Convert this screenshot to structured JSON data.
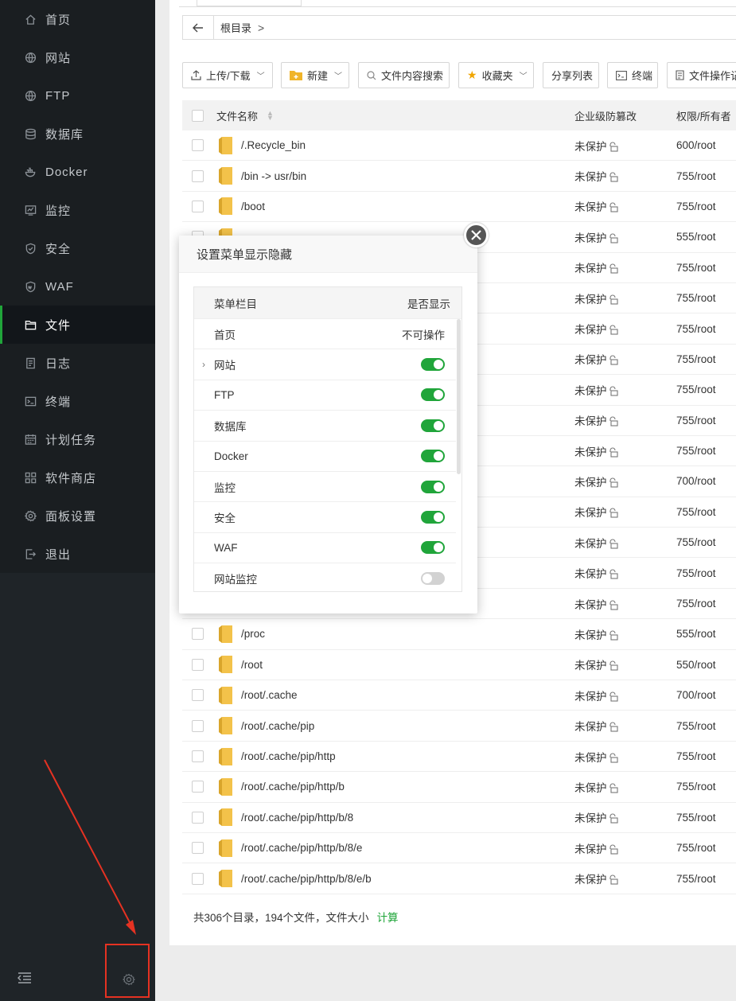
{
  "sidebar": {
    "items": [
      {
        "label": "首页",
        "icon": "home-icon"
      },
      {
        "label": "网站",
        "icon": "globe-icon"
      },
      {
        "label": "FTP",
        "icon": "ftp-globe-icon"
      },
      {
        "label": "数据库",
        "icon": "database-icon"
      },
      {
        "label": "Docker",
        "icon": "docker-icon"
      },
      {
        "label": "监控",
        "icon": "monitor-icon"
      },
      {
        "label": "安全",
        "icon": "shield-icon"
      },
      {
        "label": "WAF",
        "icon": "waf-shield-icon"
      },
      {
        "label": "文件",
        "icon": "folder-icon"
      },
      {
        "label": "日志",
        "icon": "log-icon"
      },
      {
        "label": "终端",
        "icon": "terminal-icon"
      },
      {
        "label": "计划任务",
        "icon": "calendar-icon"
      },
      {
        "label": "软件商店",
        "icon": "apps-icon"
      },
      {
        "label": "面板设置",
        "icon": "gear-icon"
      },
      {
        "label": "退出",
        "icon": "logout-icon"
      }
    ],
    "active_index": 8
  },
  "pathbar": {
    "crumb": "根目录",
    "separator": ">"
  },
  "toolbar": {
    "upload_download": "上传/下载",
    "new": "新建",
    "content_search": "文件内容搜索",
    "favorites": "收藏夹",
    "share_list": "分享列表",
    "terminal": "终端",
    "file_ops_log": "文件操作记"
  },
  "table": {
    "col_name": "文件名称",
    "col_protect": "企业级防篡改",
    "col_perm": "权限/所有者",
    "rows": [
      {
        "name": "/.Recycle_bin",
        "protect": "未保护",
        "perm": "600/root"
      },
      {
        "name": "/bin -> usr/bin",
        "protect": "未保护",
        "perm": "755/root"
      },
      {
        "name": "/boot",
        "protect": "未保护",
        "perm": "755/root"
      },
      {
        "name": "",
        "protect": "未保护",
        "perm": "555/root"
      },
      {
        "name": "",
        "protect": "未保护",
        "perm": "755/root"
      },
      {
        "name": "",
        "protect": "未保护",
        "perm": "755/root"
      },
      {
        "name": "",
        "protect": "未保护",
        "perm": "755/root"
      },
      {
        "name": "",
        "protect": "未保护",
        "perm": "755/root"
      },
      {
        "name": "",
        "protect": "未保护",
        "perm": "755/root"
      },
      {
        "name": "",
        "protect": "未保护",
        "perm": "755/root"
      },
      {
        "name": "",
        "protect": "未保护",
        "perm": "755/root"
      },
      {
        "name": "",
        "protect": "未保护",
        "perm": "700/root"
      },
      {
        "name": "",
        "protect": "未保护",
        "perm": "755/root"
      },
      {
        "name": "",
        "protect": "未保护",
        "perm": "755/root"
      },
      {
        "name": "",
        "protect": "未保护",
        "perm": "755/root"
      },
      {
        "name": "",
        "protect": "未保护",
        "perm": "755/root"
      },
      {
        "name": "/proc",
        "protect": "未保护",
        "perm": "555/root"
      },
      {
        "name": "/root",
        "protect": "未保护",
        "perm": "550/root"
      },
      {
        "name": "/root/.cache",
        "protect": "未保护",
        "perm": "700/root"
      },
      {
        "name": "/root/.cache/pip",
        "protect": "未保护",
        "perm": "755/root"
      },
      {
        "name": "/root/.cache/pip/http",
        "protect": "未保护",
        "perm": "755/root"
      },
      {
        "name": "/root/.cache/pip/http/b",
        "protect": "未保护",
        "perm": "755/root"
      },
      {
        "name": "/root/.cache/pip/http/b/8",
        "protect": "未保护",
        "perm": "755/root"
      },
      {
        "name": "/root/.cache/pip/http/b/8/e",
        "protect": "未保护",
        "perm": "755/root"
      },
      {
        "name": "/root/.cache/pip/http/b/8/e/b",
        "protect": "未保护",
        "perm": "755/root"
      }
    ]
  },
  "footer": {
    "summary": "共306个目录，194个文件，文件大小",
    "calc": "计算"
  },
  "modal": {
    "title": "设置菜单显示隐藏",
    "col_item": "菜单栏目",
    "col_show": "是否显示",
    "rows": [
      {
        "label": "首页",
        "state": "不可操作",
        "toggle": null,
        "expandable": false
      },
      {
        "label": "网站",
        "state": "",
        "toggle": true,
        "expandable": true
      },
      {
        "label": "FTP",
        "state": "",
        "toggle": true,
        "expandable": false
      },
      {
        "label": "数据库",
        "state": "",
        "toggle": true,
        "expandable": false
      },
      {
        "label": "Docker",
        "state": "",
        "toggle": true,
        "expandable": false
      },
      {
        "label": "监控",
        "state": "",
        "toggle": true,
        "expandable": false
      },
      {
        "label": "安全",
        "state": "",
        "toggle": true,
        "expandable": false
      },
      {
        "label": "WAF",
        "state": "",
        "toggle": true,
        "expandable": false
      },
      {
        "label": "网站监控",
        "state": "",
        "toggle": false,
        "expandable": false
      }
    ]
  },
  "colors": {
    "accent": "#20a53a",
    "sidebar_bg": "#1f2428",
    "highlight": "#e53222"
  }
}
